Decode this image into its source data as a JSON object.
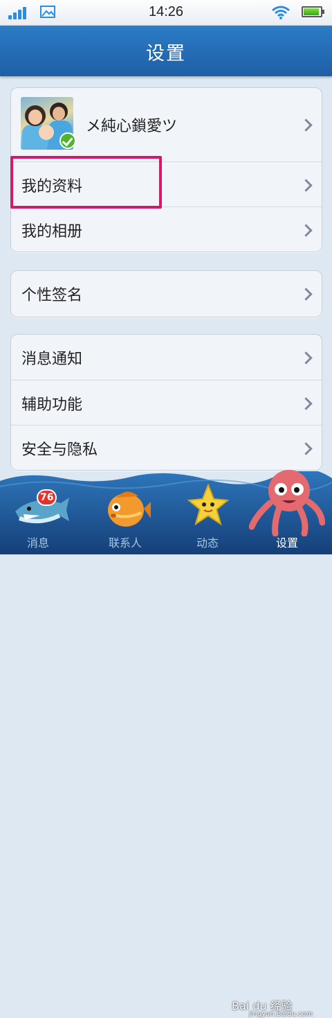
{
  "status_bar": {
    "time": "14:26",
    "icons": [
      "signal-icon",
      "gallery-icon",
      "wifi-icon",
      "battery-icon"
    ]
  },
  "header": {
    "title": "设置"
  },
  "profile_group": {
    "name": "メ純心鎖愛ツ",
    "rows": [
      {
        "label": "我的资料"
      },
      {
        "label": "我的相册"
      }
    ]
  },
  "signature_group": {
    "rows": [
      {
        "label": "个性签名"
      }
    ]
  },
  "prefs_group": {
    "rows": [
      {
        "label": "消息通知"
      },
      {
        "label": "辅助功能"
      },
      {
        "label": "安全与隐私"
      }
    ]
  },
  "tabbar": {
    "tabs": [
      {
        "label": "消息",
        "icon": "shark-icon",
        "badge": "76"
      },
      {
        "label": "联系人",
        "icon": "fish-icon"
      },
      {
        "label": "动态",
        "icon": "starfish-icon"
      },
      {
        "label": "设置",
        "icon": "octopus-icon",
        "active": true
      }
    ]
  },
  "watermark": {
    "brand": "Bai du 经验",
    "url": "jingyan.baidu.com"
  },
  "colors": {
    "header_blue": "#1e5fa5",
    "highlight": "#d8166b",
    "badge": "#e2322d"
  }
}
